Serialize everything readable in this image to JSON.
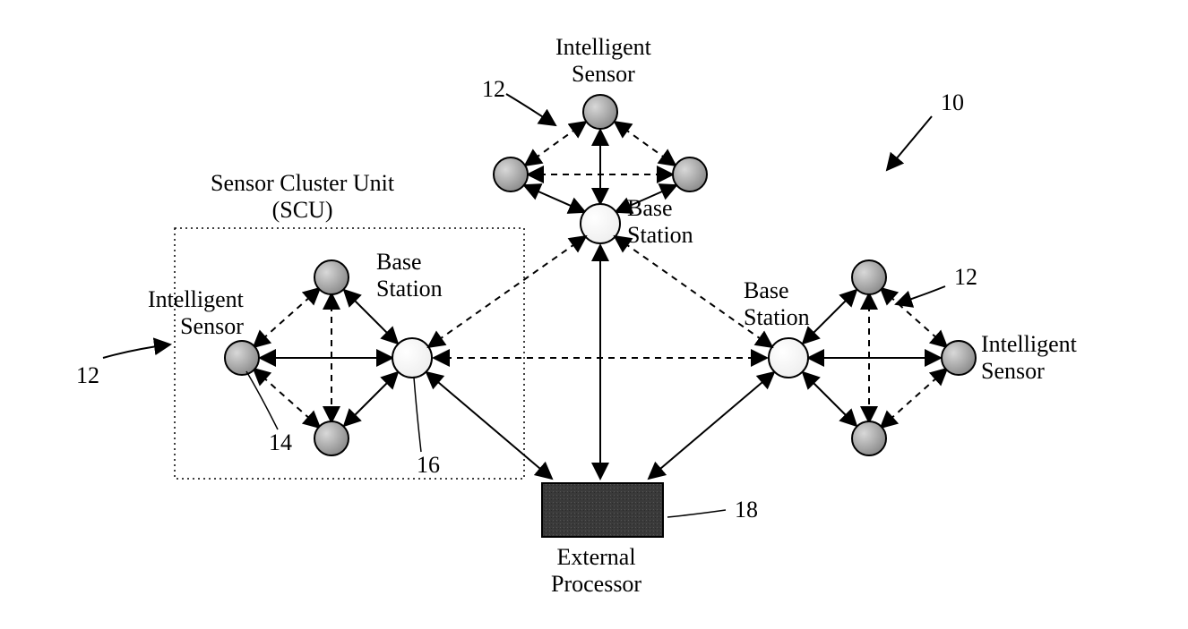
{
  "labels": {
    "scu_title": "Sensor Cluster Unit\n(SCU)",
    "intelligent_sensor": "Intelligent\nSensor",
    "base_station": "Base\nStation",
    "external_processor": "External\nProcessor",
    "ref_10": "10",
    "ref_12": "12",
    "ref_14": "14",
    "ref_16": "16",
    "ref_18": "18"
  },
  "diagram": {
    "description": "Network diagram: three Sensor Cluster Units (SCU), each composed of three Intelligent Sensors surrounding one Base Station. Base Stations connect to each other (dashed) and to an External Processor (solid). Reference numerals: 10=overall system, 12=SCU, 14=Intelligent Sensor, 16=Base Station, 18=External Processor.",
    "components": [
      {
        "id": "scu_left",
        "type": "SCU",
        "ref": 12,
        "has_box": true
      },
      {
        "id": "scu_top",
        "type": "SCU",
        "ref": 12,
        "has_box": false
      },
      {
        "id": "scu_right",
        "type": "SCU",
        "ref": 12,
        "has_box": false
      },
      {
        "id": "ext_proc",
        "type": "ExternalProcessor",
        "ref": 18
      }
    ],
    "connections": {
      "sensor_to_base": "solid double-arrow",
      "sensor_to_sensor": "dashed double-arrow",
      "base_to_base": "dashed double-arrow",
      "base_to_processor": "solid double-arrow"
    }
  }
}
